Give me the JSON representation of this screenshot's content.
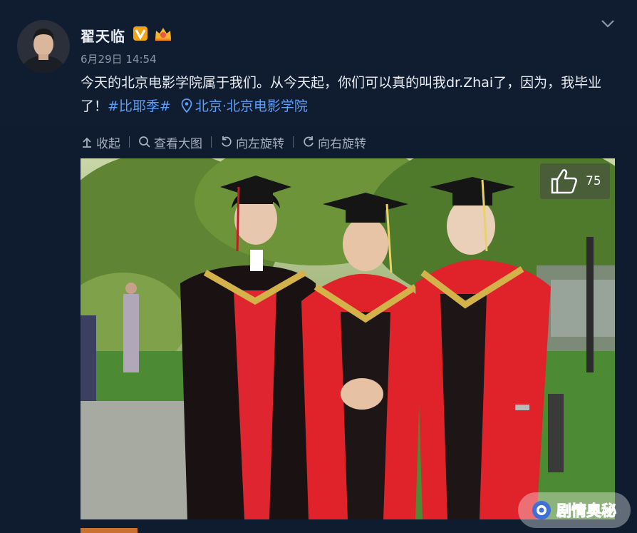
{
  "post": {
    "username": "翟天临",
    "time": "6月29日 14:54",
    "text_main": "今天的北京电影学院属于我们。从今天起，你们可以真的叫我dr.Zhai了，因为，我毕业了！",
    "topic": "#比耶季#",
    "location": "北京·北京电影学院"
  },
  "toolbar": {
    "collapse": "收起",
    "view_large": "查看大图",
    "rotate_left": "向左旋转",
    "rotate_right": "向右旋转"
  },
  "photo": {
    "like_count": "75"
  },
  "watermark": {
    "text": "剧情奥秘"
  },
  "colors": {
    "background": "#0f1c30",
    "link": "#5d9df5",
    "badge_v": "#f2a417",
    "gown_red": "#e0222b"
  },
  "icons": [
    "chevron-down-icon",
    "verified-v-icon",
    "vip-crown-icon",
    "location-pin-icon",
    "collapse-arrow-icon",
    "search-icon",
    "rotate-left-icon",
    "rotate-right-icon",
    "thumbs-up-icon"
  ]
}
